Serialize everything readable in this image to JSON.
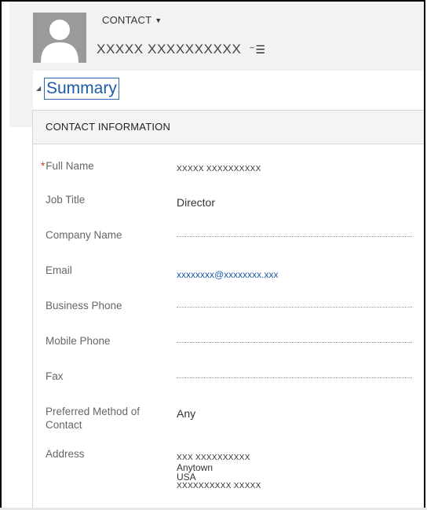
{
  "header": {
    "entity_type": "CONTACT",
    "record_name": "XXXXX XXXXXXXXXX",
    "entity_caret_icon": "caret-down-icon",
    "nav_menu_icon": "list-menu-icon",
    "avatar_icon": "person-silhouette-icon"
  },
  "section": {
    "title": "Summary",
    "toggle_icon": "triangle-collapse-icon"
  },
  "panel": {
    "title": "CONTACT INFORMATION",
    "fields": {
      "full_name": {
        "label": "Full Name",
        "required_mark": "*",
        "value": "XXXXX XXXXXXXXXX"
      },
      "job_title": {
        "label": "Job Title",
        "value": "Director"
      },
      "company_name": {
        "label": "Company Name",
        "value": ""
      },
      "email": {
        "label": "Email",
        "value": "xxxxxxxx@xxxxxxxx.xxx"
      },
      "business_phone": {
        "label": "Business Phone",
        "value": ""
      },
      "mobile_phone": {
        "label": "Mobile Phone",
        "value": ""
      },
      "fax": {
        "label": "Fax",
        "value": ""
      },
      "preferred_contact": {
        "label": "Preferred Method of Contact",
        "value": "Any"
      },
      "address": {
        "label": "Address",
        "line1": "XXX XXXXXXXXXX",
        "city": "Anytown",
        "country": "USA",
        "line4": "XXXXXXXXXX XXXXX"
      }
    }
  },
  "colors": {
    "link": "#1e5aa8",
    "required": "#c0392b",
    "header_bg": "#f2f2f2"
  }
}
